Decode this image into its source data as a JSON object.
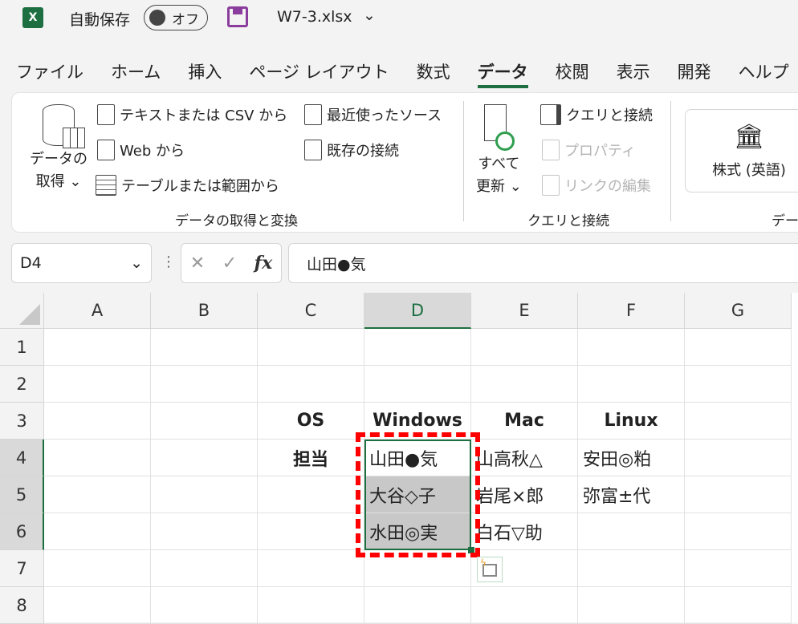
{
  "titlebar": {
    "app_icon": "X",
    "autosave_label": "自動保存",
    "autosave_state": "オフ",
    "filename": "W7-3.xlsx"
  },
  "tabs": [
    "ファイル",
    "ホーム",
    "挿入",
    "ページ レイアウト",
    "数式",
    "データ",
    "校閲",
    "表示",
    "開発",
    "ヘルプ"
  ],
  "active_tab": "データ",
  "ribbon": {
    "get_data": {
      "line1": "データの",
      "line2": "取得"
    },
    "text_csv": "テキストまたは CSV から",
    "web": "Web から",
    "table_range": "テーブルまたは範囲から",
    "recent_sources": "最近使ったソース",
    "existing_connections": "既存の接続",
    "group1": "データの取得と変換",
    "refresh_all": {
      "line1": "すべて",
      "line2": "更新"
    },
    "queries_connections": "クエリと接続",
    "properties": "プロパティ",
    "edit_links": "リンクの編集",
    "group2": "クエリと接続",
    "stocks": "株式 (英語)",
    "group3": "デー"
  },
  "formula_bar": {
    "name_box": "D4",
    "fx": "fx",
    "value": "山田●気"
  },
  "columns": [
    "A",
    "B",
    "C",
    "D",
    "E",
    "F",
    "G"
  ],
  "rows": [
    "1",
    "2",
    "3",
    "4",
    "5",
    "6",
    "7",
    "8"
  ],
  "cells": {
    "C3": "OS",
    "D3": "Windows",
    "E3": "Mac",
    "F3": "Linux",
    "C4": "担当",
    "D4": "山田●気",
    "E4": "山高秋△",
    "F4": "安田◎粕",
    "D5": "大谷◇子",
    "E5": "岩尾×郎",
    "F5": "弥富±代",
    "D6": "水田◎実",
    "E6": "白石▽助"
  },
  "colors": {
    "accent": "#1d6f42",
    "highlight": "#ff0000",
    "selection_fill": "#c8c8c8"
  }
}
